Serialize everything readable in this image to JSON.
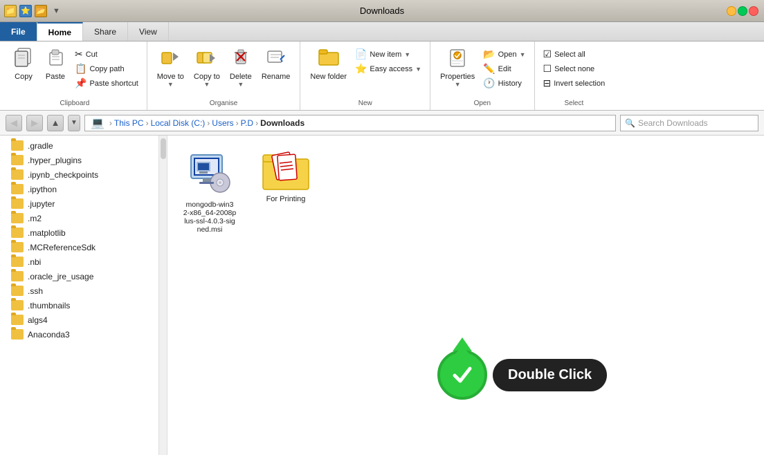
{
  "titleBar": {
    "title": "Downloads"
  },
  "ribbonTabs": [
    {
      "id": "file",
      "label": "File"
    },
    {
      "id": "home",
      "label": "Home",
      "active": true
    },
    {
      "id": "share",
      "label": "Share"
    },
    {
      "id": "view",
      "label": "View"
    }
  ],
  "ribbon": {
    "groups": {
      "clipboard": {
        "label": "Clipboard",
        "copy_label": "Copy",
        "paste_label": "Paste",
        "cut_label": "Cut",
        "copy_path_label": "Copy path",
        "paste_shortcut_label": "Paste shortcut"
      },
      "organise": {
        "label": "Organise",
        "move_to_label": "Move to",
        "copy_to_label": "Copy to",
        "delete_label": "Delete",
        "rename_label": "Rename"
      },
      "new": {
        "label": "New",
        "new_folder_label": "New folder",
        "new_item_label": "New item",
        "easy_access_label": "Easy access"
      },
      "open": {
        "label": "Open",
        "properties_label": "Properties",
        "open_label": "Open",
        "edit_label": "Edit",
        "history_label": "History"
      },
      "select": {
        "label": "Select",
        "select_all_label": "Select all",
        "select_none_label": "Select none",
        "invert_selection_label": "Invert selection"
      }
    }
  },
  "addressBar": {
    "back_title": "Back",
    "forward_title": "Forward",
    "up_title": "Up",
    "breadcrumbs": [
      "This PC",
      "Local Disk (C:)",
      "Users",
      "P.D",
      "Downloads"
    ],
    "search_placeholder": "Search Downloads"
  },
  "sidebar": {
    "items": [
      ".gradle",
      ".hyper_plugins",
      ".ipynb_checkpoints",
      ".ipython",
      ".jupyter",
      ".m2",
      ".matplotlib",
      ".MCReferenceSdk",
      ".nbi",
      ".oracle_jre_usage",
      ".ssh",
      ".thumbnails",
      "algs4",
      "Anaconda3"
    ]
  },
  "files": [
    {
      "name": "mongodb-win32-x86_64-2008plus-ssl-4.0.3-signed.msi",
      "type": "msi",
      "short_name": "mongodb-win3\n2-x86_64-2008p\nlus-ssl-4.0.3-sig\nned.msi"
    },
    {
      "name": "For Printing",
      "type": "folder"
    }
  ],
  "overlay": {
    "label": "Double Click"
  }
}
